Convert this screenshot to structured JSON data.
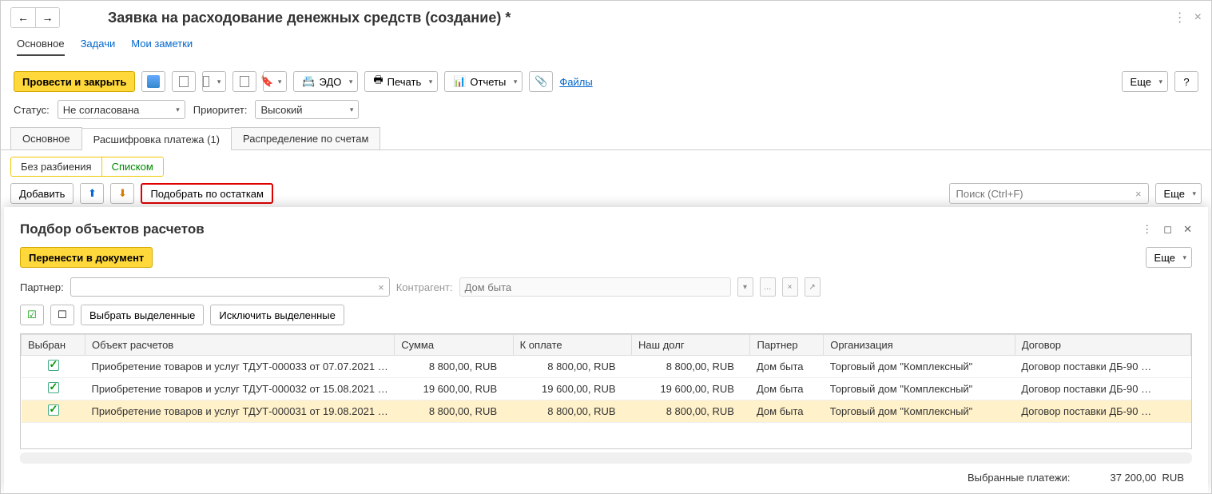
{
  "header": {
    "title": "Заявка на расходование денежных средств (создание) *"
  },
  "subnav": {
    "main": "Основное",
    "tasks": "Задачи",
    "notes": "Мои заметки"
  },
  "toolbar": {
    "post_close": "Провести и закрыть",
    "edo": "ЭДО",
    "print": "Печать",
    "reports": "Отчеты",
    "files": "Файлы",
    "more": "Еще"
  },
  "status": {
    "label": "Статус:",
    "value": "Не согласована",
    "prio_label": "Приоритет:",
    "prio_value": "Высокий"
  },
  "tabs": {
    "main": "Основное",
    "details": "Расшифровка платежа (1)",
    "alloc": "Распределение по счетам"
  },
  "pills": {
    "nosplit": "Без разбиения",
    "list": "Списком"
  },
  "row": {
    "add": "Добавить",
    "pick": "Подобрать по остаткам",
    "search_ph": "Поиск (Ctrl+F)",
    "more": "Еще"
  },
  "panel": {
    "title": "Подбор объектов расчетов",
    "transfer": "Перенести в документ",
    "more": "Еще",
    "partner_label": "Партнер:",
    "contr_label": "Контрагент:",
    "contr_value": "Дом быта",
    "sel_all": "Выбрать выделенные",
    "excl_all": "Исключить выделенные"
  },
  "table": {
    "cols": {
      "sel": "Выбран",
      "obj": "Объект расчетов",
      "sum": "Сумма",
      "topay": "К оплате",
      "debt": "Наш долг",
      "partner": "Партнер",
      "org": "Организация",
      "contract": "Договор"
    },
    "rows": [
      {
        "sel": true,
        "obj": "Приобретение товаров и услуг ТДУТ-000033 от 07.07.2021 …",
        "sum": "8 800,00, RUB",
        "topay": "8 800,00, RUB",
        "debt": "8 800,00, RUB",
        "partner": "Дом быта",
        "org": "Торговый дом \"Комплексный\"",
        "contract": "Договор поставки ДБ-90 …"
      },
      {
        "sel": true,
        "obj": "Приобретение товаров и услуг ТДУТ-000032 от 15.08.2021 …",
        "sum": "19 600,00, RUB",
        "topay": "19 600,00, RUB",
        "debt": "19 600,00, RUB",
        "partner": "Дом быта",
        "org": "Торговый дом \"Комплексный\"",
        "contract": "Договор поставки ДБ-90 …"
      },
      {
        "sel": true,
        "obj": "Приобретение товаров и услуг ТДУТ-000031 от 19.08.2021 …",
        "sum": "8 800,00, RUB",
        "topay": "8 800,00, RUB",
        "debt": "8 800,00, RUB",
        "partner": "Дом быта",
        "org": "Торговый дом \"Комплексный\"",
        "contract": "Договор поставки ДБ-90 …",
        "highlight": true
      }
    ]
  },
  "footer": {
    "label": "Выбранные платежи:",
    "amount": "37 200,00",
    "cur": "RUB"
  }
}
